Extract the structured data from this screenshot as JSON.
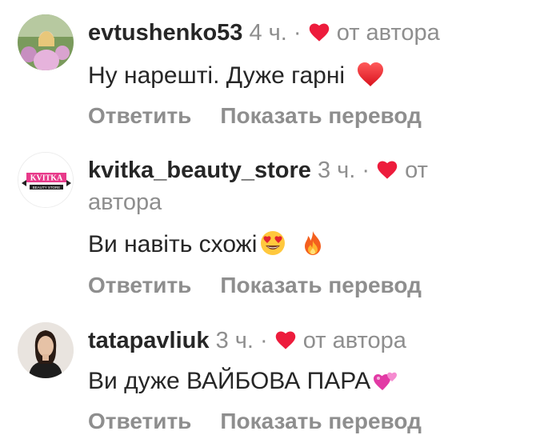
{
  "colors": {
    "text": "#262626",
    "secondary": "#8e8e8e",
    "heart": "#ed1c3c"
  },
  "comments": [
    {
      "username": "evtushenko53",
      "time": "4 ч.",
      "separator": "·",
      "author_liked": "от автора",
      "text": "Ну нарешті. Дуже гарні",
      "emoji": [
        "red-heart-emoji"
      ],
      "reply": "Ответить",
      "translate": "Показать перевод"
    },
    {
      "username": "kvitka_beauty_store",
      "time": "3 ч.",
      "separator": "·",
      "author_liked_part1": "от",
      "author_liked_part2": "автора",
      "text": "Ви навіть схожі",
      "emoji": [
        "heart-eyes-emoji",
        "fire-emoji"
      ],
      "reply": "Ответить",
      "translate": "Показать перевод",
      "avatar_logo": "KVITKA",
      "avatar_sub": "BEAUTY STORE"
    },
    {
      "username": "tatapavliuk",
      "time": "3 ч.",
      "separator": "·",
      "author_liked": "от автора",
      "text": "Ви дуже ВАЙБОВА ПАРА",
      "emoji": [
        "two-hearts-emoji"
      ],
      "reply": "Ответить",
      "translate": "Показать перевод"
    }
  ]
}
